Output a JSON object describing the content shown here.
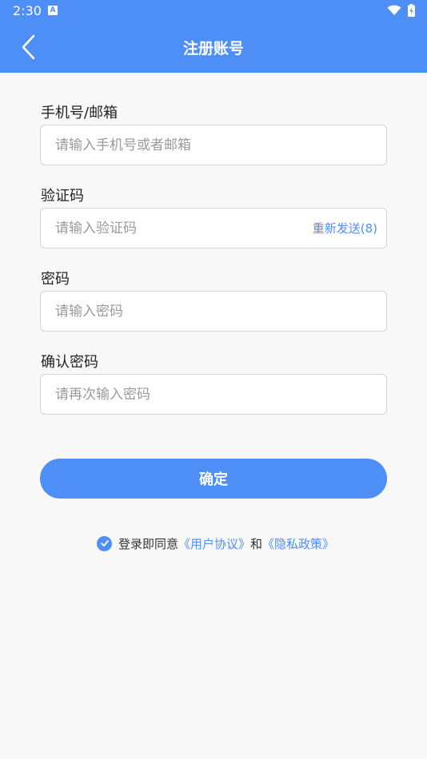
{
  "status_bar": {
    "time": "2:30",
    "notification_letter": "A"
  },
  "header": {
    "title": "注册账号"
  },
  "form": {
    "account": {
      "label": "手机号/邮箱",
      "placeholder": "请输入手机号或者邮箱",
      "value": ""
    },
    "code": {
      "label": "验证码",
      "placeholder": "请输入验证码",
      "value": "",
      "resend_label": "重新发送(8)"
    },
    "password": {
      "label": "密码",
      "placeholder": "请输入密码",
      "value": ""
    },
    "confirm_password": {
      "label": "确认密码",
      "placeholder": "请再次输入密码",
      "value": ""
    }
  },
  "confirm_button": "确定",
  "agreement": {
    "checked": true,
    "prefix": "登录即同意",
    "user_agreement": "《用户协议》",
    "conjunction": "和",
    "privacy_policy": "《隐私政策》"
  },
  "colors": {
    "primary": "#4e8ef7",
    "background": "#f8f8f8"
  }
}
